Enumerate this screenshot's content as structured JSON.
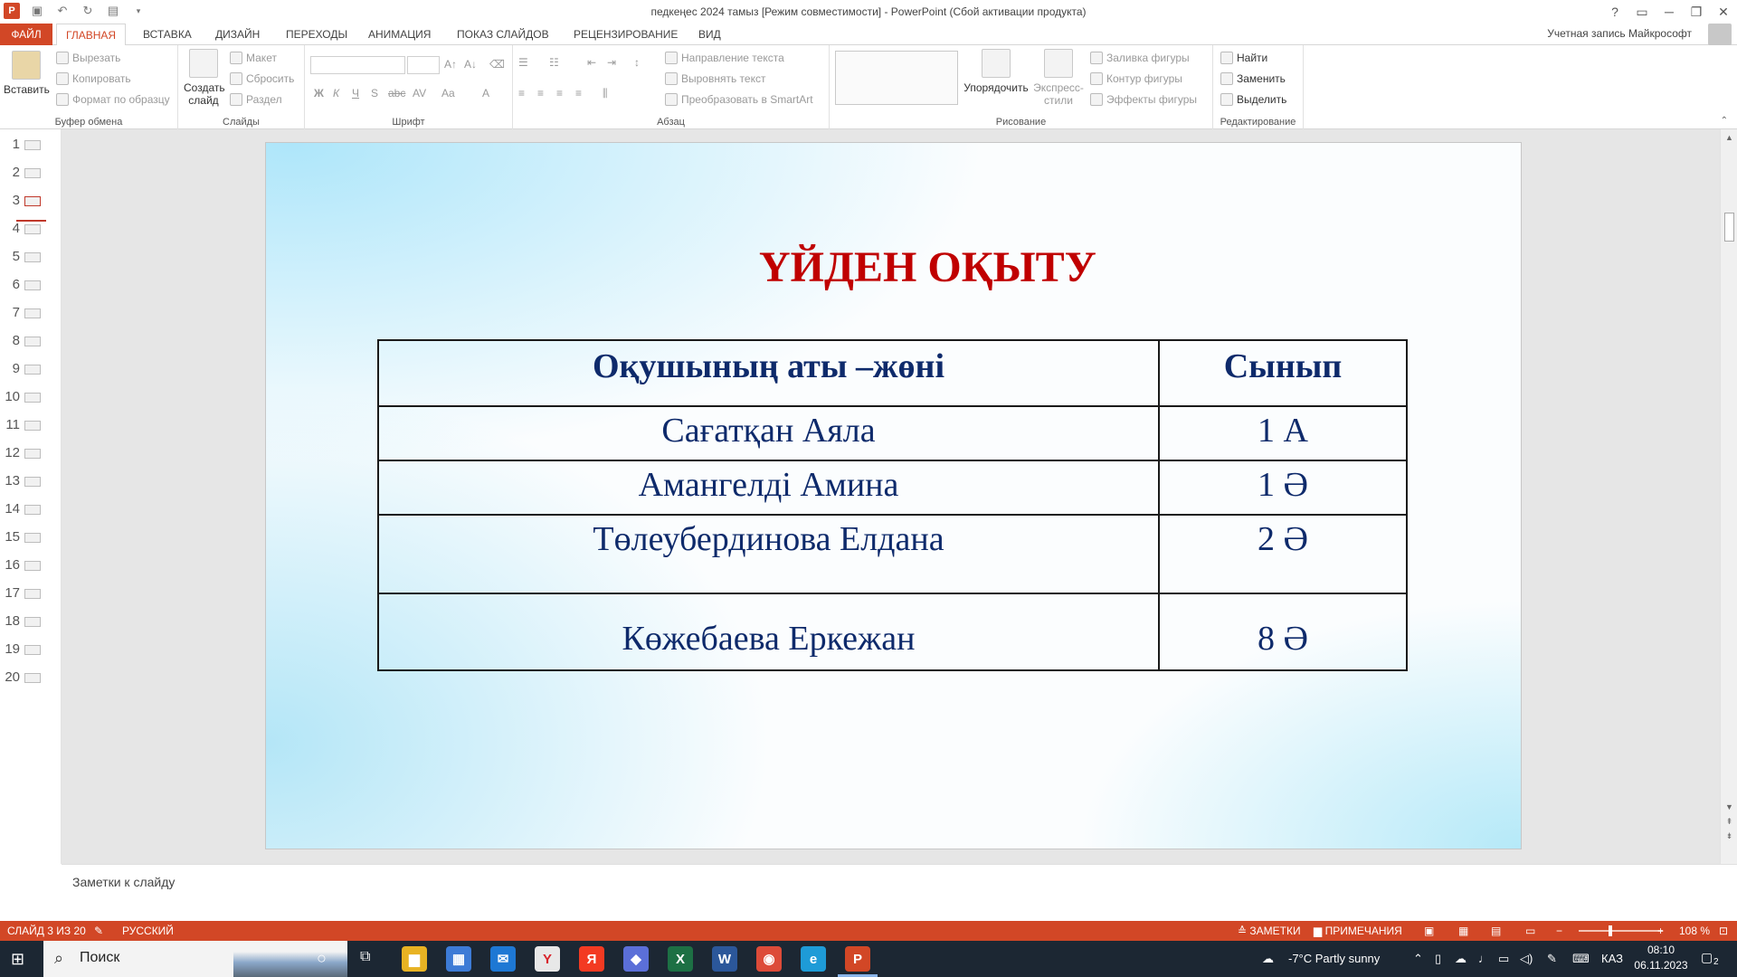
{
  "window": {
    "title": "педкеңес 2024 тамыз [Режим совместимости] - PowerPoint (Сбой активации продукта)",
    "account": "Учетная запись Майкрософт",
    "controls": [
      "?",
      "▭",
      "─",
      "❐",
      "✕"
    ]
  },
  "tabs": [
    {
      "label": "ФАЙЛ"
    },
    {
      "label": "ГЛАВНАЯ"
    },
    {
      "label": "ВСТАВКА"
    },
    {
      "label": "ДИЗАЙН"
    },
    {
      "label": "ПЕРЕХОДЫ"
    },
    {
      "label": "АНИМАЦИЯ"
    },
    {
      "label": "ПОКАЗ СЛАЙДОВ"
    },
    {
      "label": "РЕЦЕНЗИРОВАНИЕ"
    },
    {
      "label": "ВИД"
    }
  ],
  "ribbon": {
    "clipboard": {
      "group": "Буфер обмена",
      "paste": "Вставить",
      "cut": "Вырезать",
      "copy": "Копировать",
      "format_painter": "Формат по образцу"
    },
    "slides": {
      "group": "Слайды",
      "new_slide_1": "Создать",
      "new_slide_2": "слайд",
      "layout": "Макет",
      "reset": "Сбросить",
      "section": "Раздел"
    },
    "font": {
      "group": "Шрифт",
      "bold": "Ж",
      "italic": "К",
      "underline": "Ч",
      "shadow": "S",
      "strike": "abc",
      "spacing": "AV",
      "case": "Aa",
      "color": "A"
    },
    "paragraph": {
      "group": "Абзац",
      "text_direction": "Направление текста",
      "align_text": "Выровнять текст",
      "smartart": "Преобразовать в SmartArt"
    },
    "drawing": {
      "group": "Рисование",
      "arrange": "Упорядочить",
      "quick_styles_1": "Экспресс-",
      "quick_styles_2": "стили",
      "shape_fill": "Заливка фигуры",
      "shape_outline": "Контур фигуры",
      "shape_effects": "Эффекты фигуры"
    },
    "editing": {
      "group": "Редактирование",
      "find": "Найти",
      "replace": "Заменить",
      "select": "Выделить"
    }
  },
  "thumbnails": [
    "1",
    "2",
    "3",
    "4",
    "5",
    "6",
    "7",
    "8",
    "9",
    "10",
    "11",
    "12",
    "13",
    "14",
    "15",
    "16",
    "17",
    "18",
    "19",
    "20"
  ],
  "selected_slide": 3,
  "slide": {
    "title": "ҮЙДЕН ОҚЫТУ",
    "table": {
      "headers": [
        "Оқушының аты –жөні",
        "Сынып"
      ],
      "rows": [
        [
          "Сағатқан Аяла",
          "1 А"
        ],
        [
          "Амангелді Амина",
          "1 Ә"
        ],
        [
          "Төлеубердинова Елдана",
          "2 Ә"
        ],
        [
          "Көжебаева Еркежан",
          "8 Ә"
        ]
      ]
    }
  },
  "notes": {
    "placeholder": "Заметки к слайду"
  },
  "status": {
    "slide_info": "СЛАЙД 3 ИЗ 20",
    "language": "РУССКИЙ",
    "notes_btn": "ЗАМЕТКИ",
    "comments_btn": "ПРИМЕЧАНИЯ",
    "zoom": "108 %",
    "zoom_fraction": 0.54
  },
  "taskbar": {
    "search": "Поиск",
    "weather": "-7°C  Partly sunny",
    "lang": "КАЗ",
    "time": "08:10",
    "date": "06.11.2023",
    "notif_count": "2",
    "apps": [
      {
        "name": "file-explorer",
        "glyph": "▆",
        "color": "#e8b323"
      },
      {
        "name": "store",
        "glyph": "▦",
        "color": "#3d7bd6"
      },
      {
        "name": "mail",
        "glyph": "✉",
        "color": "#1e78d4"
      },
      {
        "name": "yandex-browser",
        "glyph": "Y",
        "color": "#e8e8e8"
      },
      {
        "name": "yandex",
        "glyph": "Я",
        "color": "#f33a22"
      },
      {
        "name": "copilot",
        "glyph": "◆",
        "color": "#5b6fd8"
      },
      {
        "name": "excel",
        "glyph": "X",
        "color": "#1d7044"
      },
      {
        "name": "word",
        "glyph": "W",
        "color": "#2b579a"
      },
      {
        "name": "chrome",
        "glyph": "◉",
        "color": "#dd4b39"
      },
      {
        "name": "edge",
        "glyph": "e",
        "color": "#1e9bd7"
      },
      {
        "name": "powerpoint",
        "glyph": "P",
        "color": "#d24726"
      }
    ]
  }
}
